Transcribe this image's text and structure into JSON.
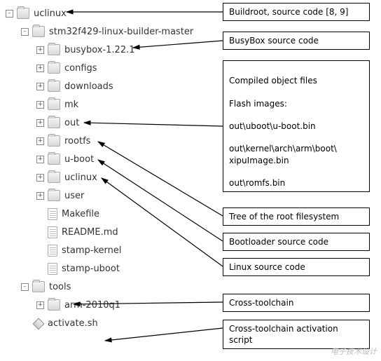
{
  "tree": {
    "root": {
      "label": "uclinux",
      "toggle": "–"
    },
    "stm32": {
      "label": "stm32f429-linux-builder-master",
      "toggle": "–"
    },
    "children": [
      {
        "label": "busybox-1.22.1",
        "toggle": "+"
      },
      {
        "label": "configs",
        "toggle": "+"
      },
      {
        "label": "downloads",
        "toggle": "+"
      },
      {
        "label": "mk",
        "toggle": "+"
      },
      {
        "label": "out",
        "toggle": "+"
      },
      {
        "label": "rootfs",
        "toggle": "+"
      },
      {
        "label": "u-boot",
        "toggle": "+"
      },
      {
        "label": "uclinux",
        "toggle": "+"
      },
      {
        "label": "user",
        "toggle": "+"
      }
    ],
    "files": [
      {
        "label": "Makefile",
        "type": "file"
      },
      {
        "label": "README.md",
        "type": "file"
      },
      {
        "label": "stamp-kernel",
        "type": "file"
      },
      {
        "label": "stamp-uboot",
        "type": "file"
      }
    ],
    "tools": {
      "label": "tools",
      "toggle": "–"
    },
    "tools_children": [
      {
        "label": "arm-2010q1",
        "toggle": "+"
      },
      {
        "label": "activate.sh",
        "type": "diamond"
      }
    ]
  },
  "annotations": {
    "buildroot": "Buildroot, source code [8, 9]",
    "busybox": "BusyBox source code",
    "compiled": "Compiled object files\n\nFlash images:\n\nout\\uboot\\u-boot.bin\n\nout\\kernel\\arch\\arm\\boot\\\nxipuImage.bin\n\nout\\romfs.bin",
    "rootfs": "Tree of the root filesystem",
    "uboot": "Bootloader source code",
    "uclinux": "Linux source code",
    "tools": "Cross-toolchain",
    "activate": "Cross-toolchain activation script"
  },
  "watermark": "电子技术设计"
}
